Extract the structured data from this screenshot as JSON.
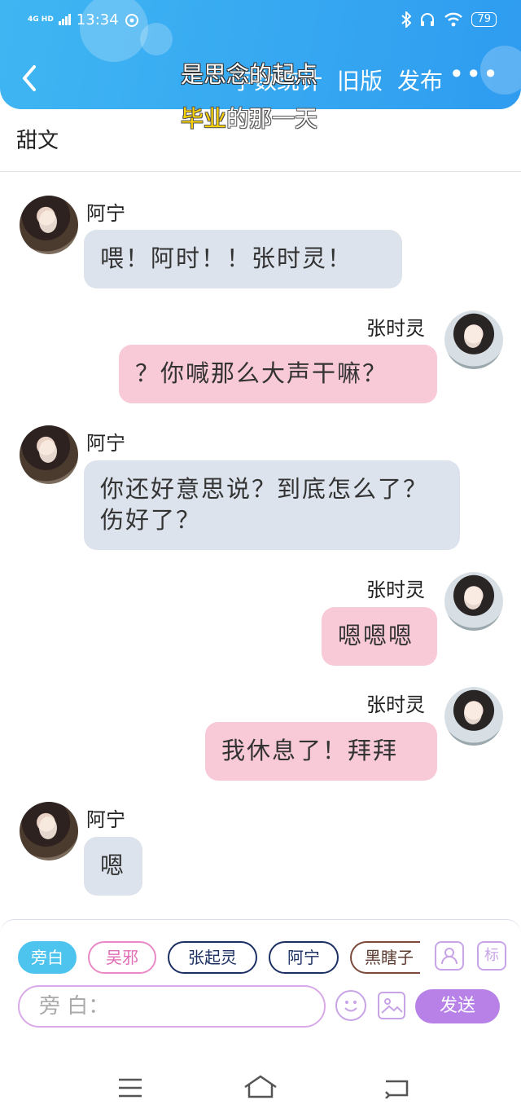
{
  "status_bar": {
    "network": "4G HD",
    "time": "13:34",
    "battery": "79"
  },
  "header": {
    "overlay_line1": "是思念的起点",
    "overlay_line2_highlight": "毕业",
    "overlay_line2_rest": "的那一天",
    "actions": [
      "字数统计",
      "旧版",
      "发布"
    ],
    "more": "•••"
  },
  "story_title": "甜文",
  "messages": [
    {
      "side": "left",
      "sender": "阿宁",
      "text": "喂！阿时！！张时灵！"
    },
    {
      "side": "right",
      "sender": "张时灵",
      "text": "？你喊那么大声干嘛？"
    },
    {
      "side": "left",
      "sender": "阿宁",
      "text": "你还好意思说？到底怎么了？伤好了？"
    },
    {
      "side": "right",
      "sender": "张时灵",
      "text": "嗯嗯嗯"
    },
    {
      "side": "right",
      "sender": "张时灵",
      "text": "我休息了！拜拜"
    },
    {
      "side": "left",
      "sender": "阿宁",
      "text": "嗯"
    }
  ],
  "composer": {
    "roles": [
      "旁白",
      "吴邪",
      "张起灵",
      "阿宁",
      "黑瞎子"
    ],
    "tag_label": "标",
    "input_placeholder": "旁 白：",
    "send_label": "发送"
  },
  "colors": {
    "header": "#2f9cf0",
    "left_bubble": "#dde3ec",
    "right_bubble": "#f8cad8",
    "send": "#b781e8",
    "active_chip": "#4cc4ee"
  }
}
